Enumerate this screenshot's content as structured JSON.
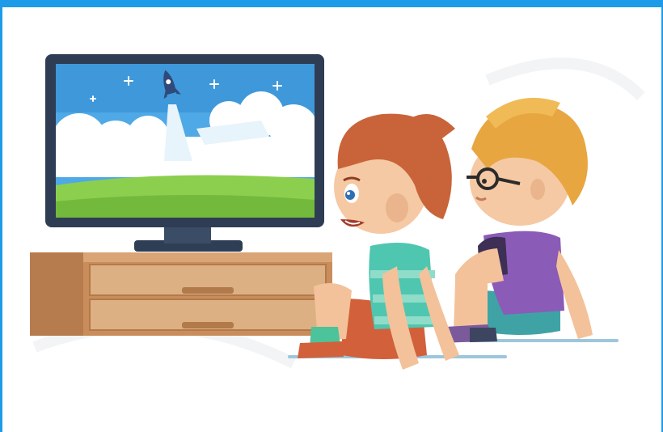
{
  "scene": {
    "subject": "two-boys-watching-tv",
    "colors": {
      "frame_border": "#1e9be8",
      "sky": "#4fa9e6",
      "grass": "#8ccf4e",
      "cabinet": "#c98d5b",
      "boy_front_hair": "#c9643a",
      "boy_back_hair": "#e8a640",
      "boy_back_shirt": "#8a5bb7",
      "boy_front_shirt": "#4fc6b0"
    },
    "icons": [
      "rocket-icon",
      "sparkle-icon",
      "cloud-icon"
    ]
  }
}
